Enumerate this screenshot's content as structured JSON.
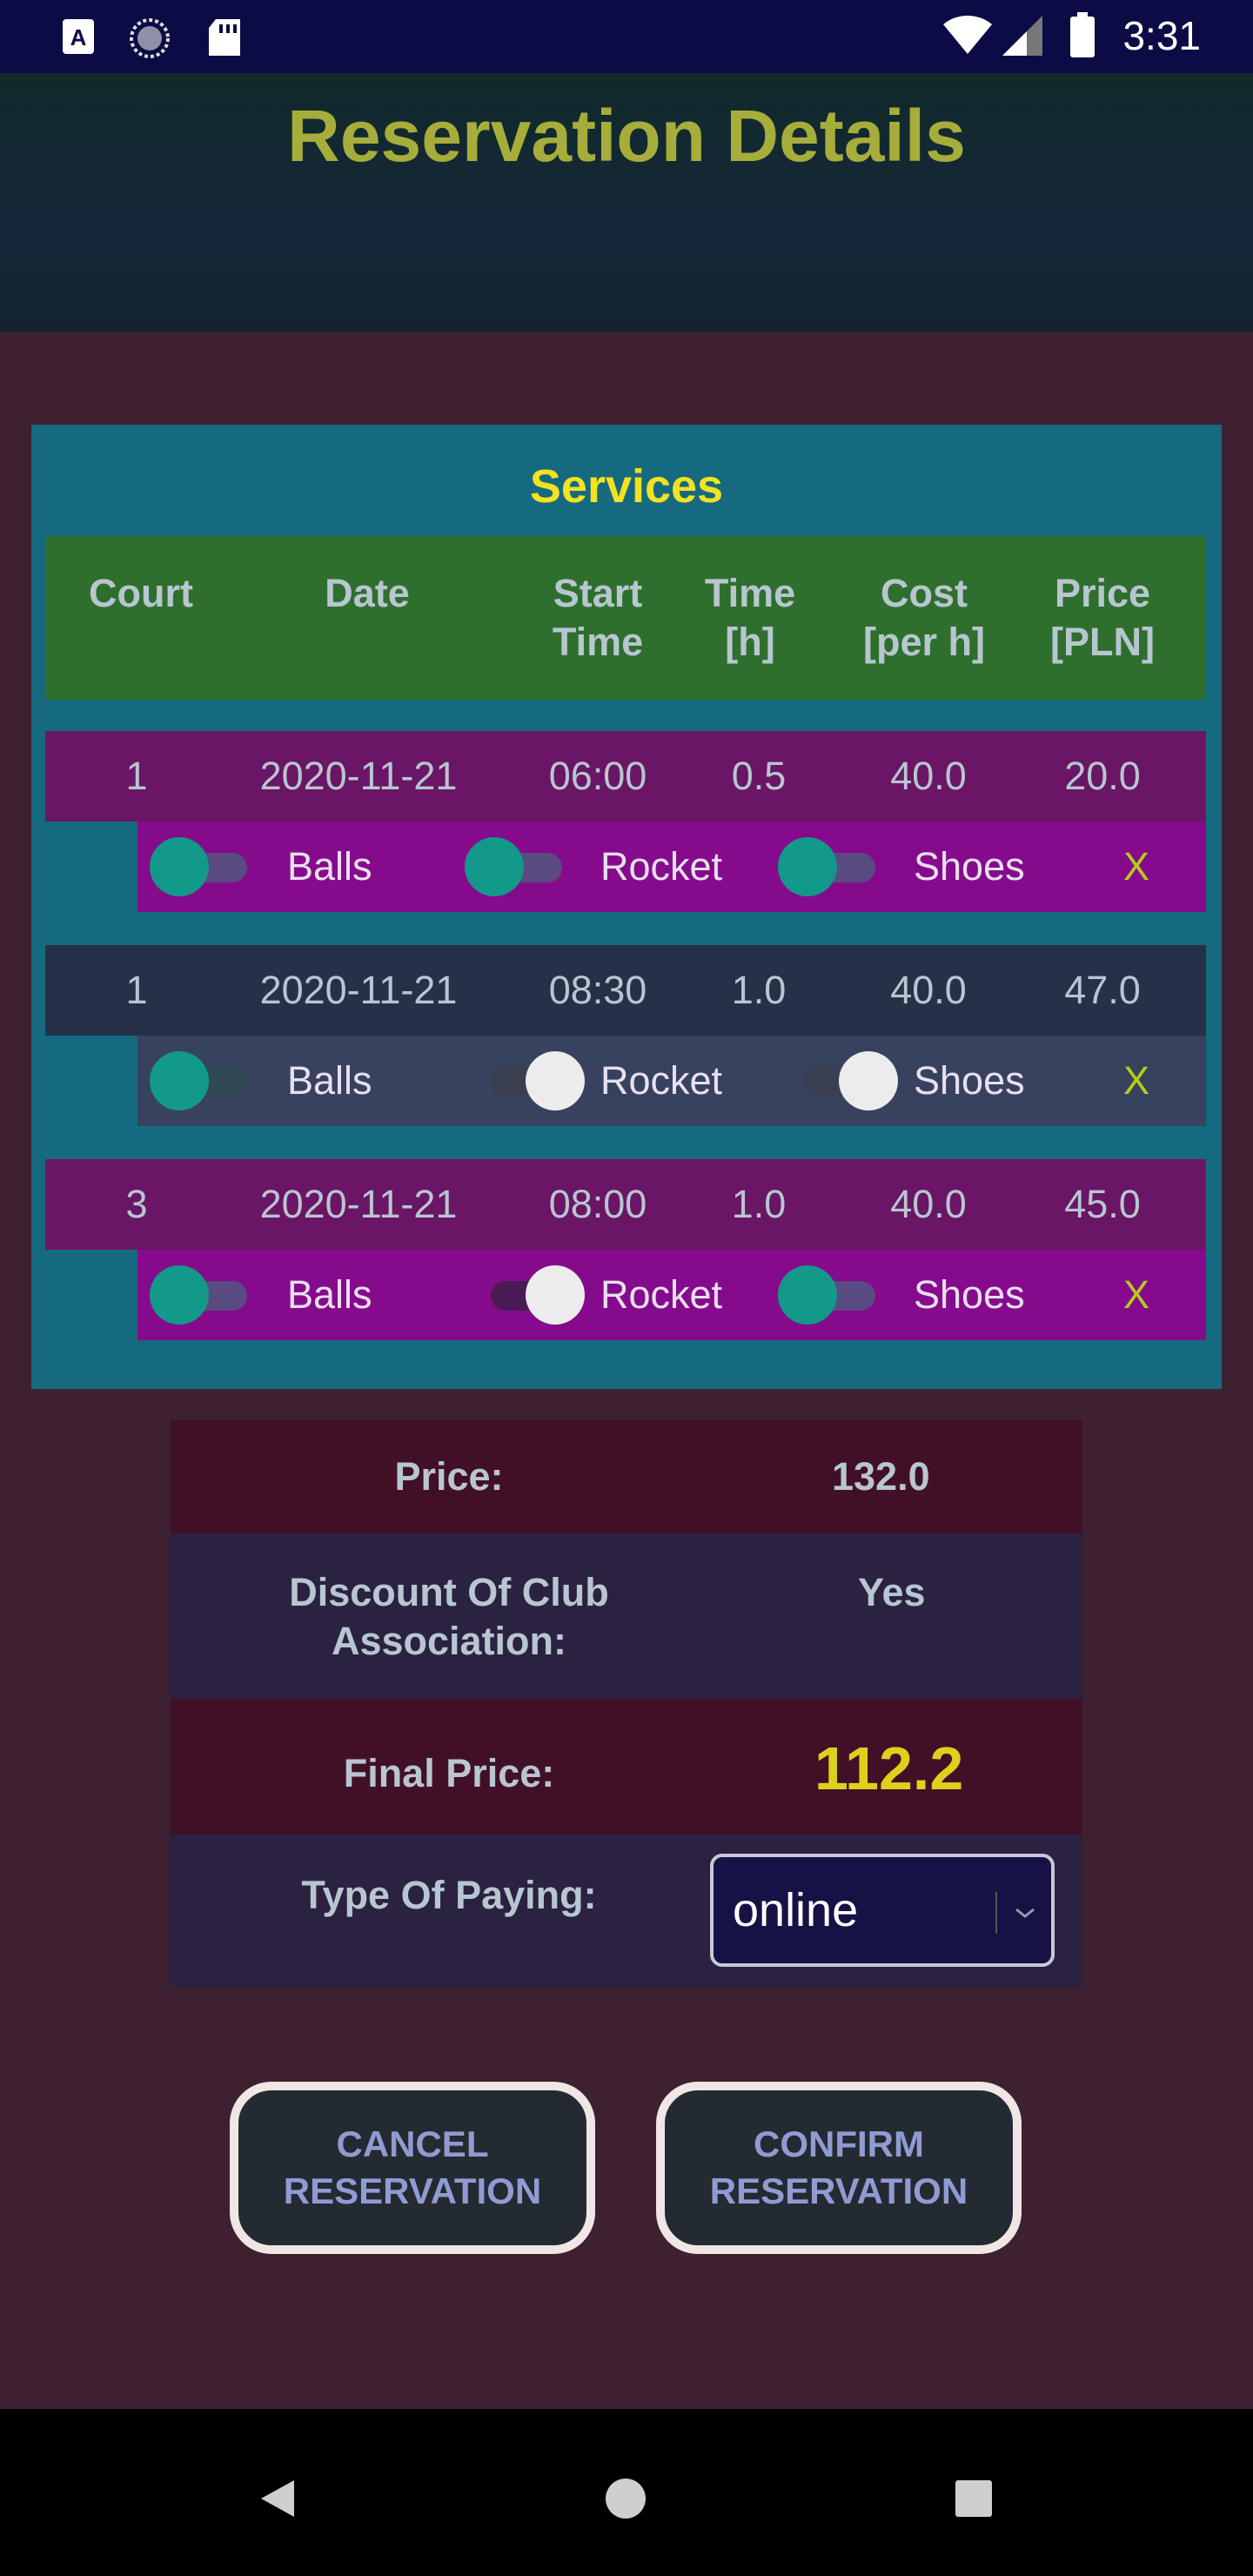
{
  "status_bar": {
    "time": "3:31",
    "icons": [
      "a-keyboard-icon",
      "spinner-icon",
      "sd-card-icon",
      "wifi-icon",
      "signal-icon",
      "battery-icon"
    ]
  },
  "header": {
    "title": "Reservation Details"
  },
  "services": {
    "title": "Services",
    "columns": [
      "Court",
      "Date",
      "Start\nTime",
      "Time\n[h]",
      "Cost\n[per h]",
      "Price\n[PLN]"
    ],
    "rows": [
      {
        "court": "1",
        "date": "2020-11-21",
        "start": "06:00",
        "time": "0.5",
        "cost": "40.0",
        "price": "20.0",
        "balls": "Balls",
        "rocket": "Rocket",
        "shoes": "Shoes",
        "remove": "X",
        "balls_on": true,
        "rocket_on": true,
        "shoes_on": true
      },
      {
        "court": "1",
        "date": "2020-11-21",
        "start": "08:30",
        "time": "1.0",
        "cost": "40.0",
        "price": "47.0",
        "balls": "Balls",
        "rocket": "Rocket",
        "shoes": "Shoes",
        "remove": "X",
        "balls_on": true,
        "rocket_on": false,
        "shoes_on": false
      },
      {
        "court": "3",
        "date": "2020-11-21",
        "start": "08:00",
        "time": "1.0",
        "cost": "40.0",
        "price": "45.0",
        "balls": "Balls",
        "rocket": "Rocket",
        "shoes": "Shoes",
        "remove": "X",
        "balls_on": true,
        "rocket_on": false,
        "shoes_on": true
      }
    ]
  },
  "summary": {
    "price_label": "Price:",
    "price_value": "132.0",
    "discount_label": "Discount Of Club\nAssociation:",
    "discount_value": "Yes",
    "final_label": "Final Price:",
    "final_value": "112.2",
    "paying_label": "Type Of Paying:",
    "paying_value": "online"
  },
  "buttons": {
    "cancel": "CANCEL\nRESERVATION",
    "confirm": "CONFIRM\nRESERVATION"
  },
  "colors": {
    "background": "#3d2130",
    "title": "#a7ad3a",
    "services_title": "#f2e220",
    "final_price": "#dcd21e",
    "toggle_on": "#12998a",
    "remove_x": "#b5cc1a"
  }
}
